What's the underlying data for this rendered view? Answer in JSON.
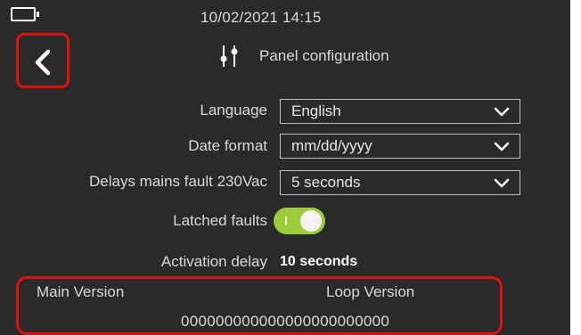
{
  "status_bar": {
    "datetime": "10/02/2021  14:15",
    "battery_icon": "battery-icon"
  },
  "header": {
    "back_icon": "chevron-left-icon",
    "panel_icon": "sliders-icon",
    "title": "Panel configuration"
  },
  "settings": {
    "language": {
      "label": "Language",
      "value": "English"
    },
    "date_format": {
      "label": "Date format",
      "value": "mm/dd/yyyy"
    },
    "mains_fault_delay": {
      "label": "Delays mains fault 230Vac",
      "value": "5 seconds"
    },
    "latched_faults": {
      "label": "Latched faults",
      "enabled": true,
      "on_mark": "I"
    },
    "activation_delay": {
      "label": "Activation delay",
      "value": "10 seconds"
    }
  },
  "versions": {
    "main_label": "Main Version",
    "loop_label": "Loop Version",
    "value": "000000000000000000000000"
  },
  "colors": {
    "background": "#2a2a2a",
    "highlight": "#e01010",
    "toggle_on": "#9ccc3a"
  }
}
